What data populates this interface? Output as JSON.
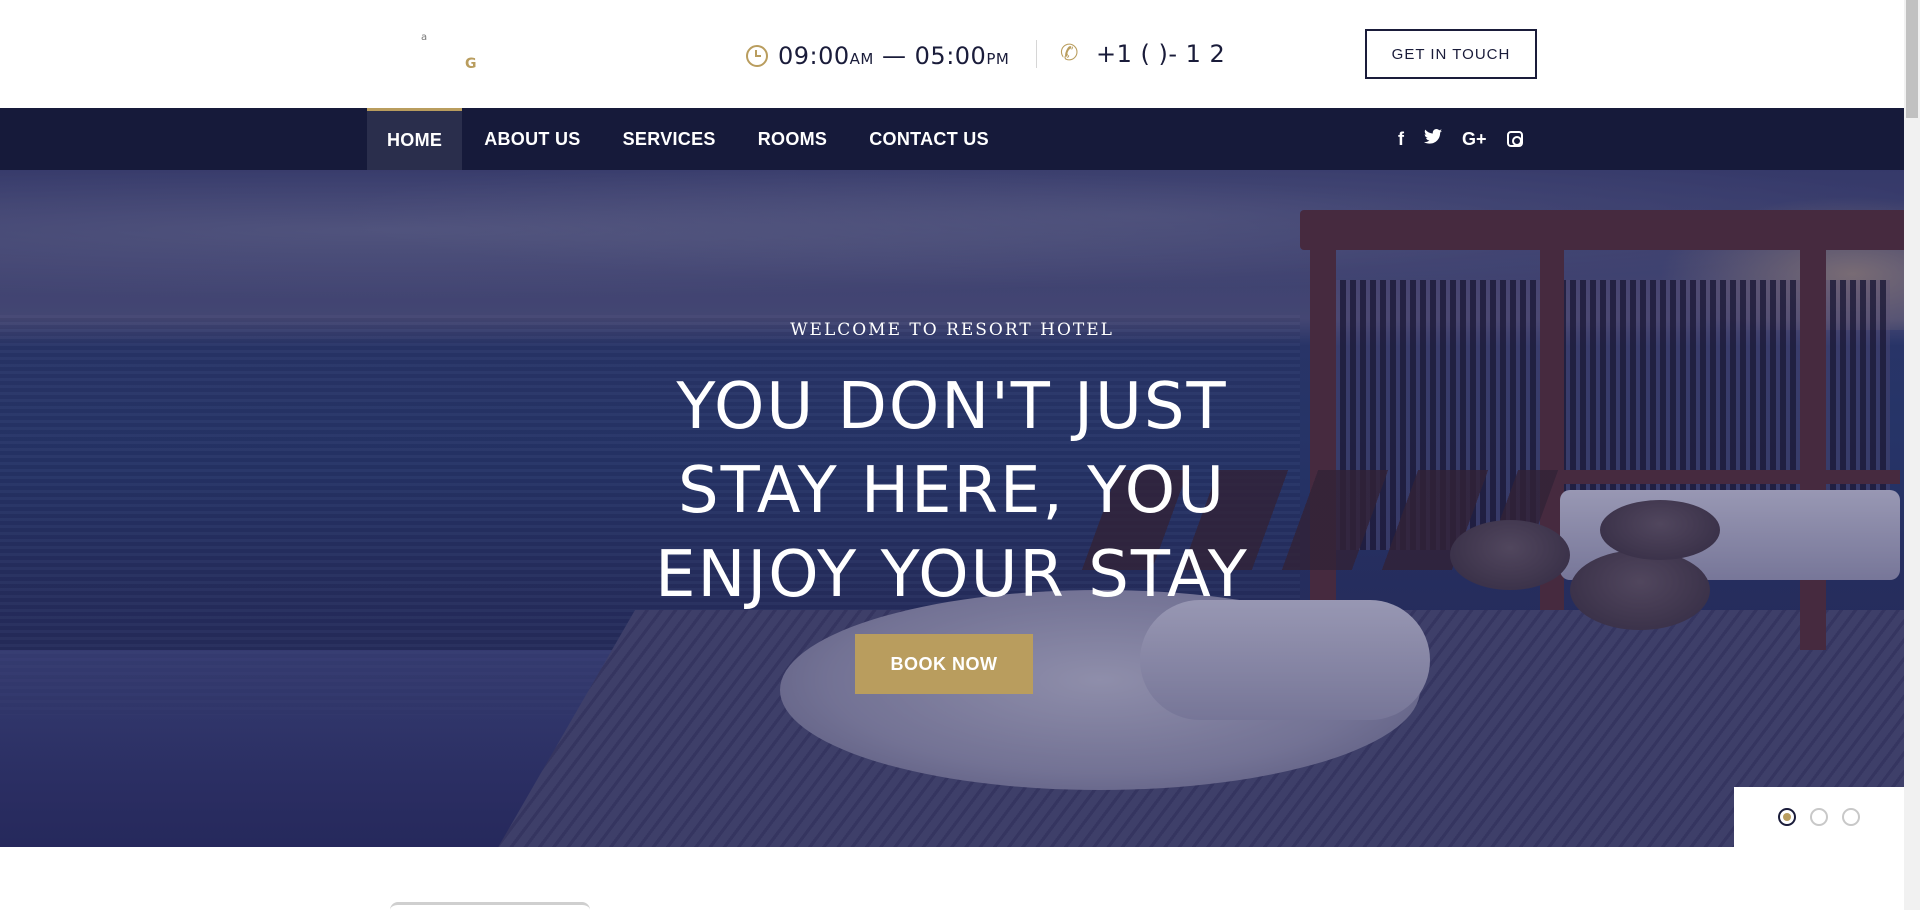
{
  "header": {
    "logo": {
      "line1": "a",
      "line2": "G"
    },
    "hours": {
      "open": "09:00",
      "open_suffix": "AM",
      "separator": "—",
      "close": "05:00",
      "close_suffix": "PM"
    },
    "phone": "+1 (   )-     1   2",
    "cta_label": "GET IN TOUCH"
  },
  "nav": {
    "items": [
      {
        "label": "HOME",
        "active": true
      },
      {
        "label": "ABOUT US",
        "active": false
      },
      {
        "label": "SERVICES",
        "active": false
      },
      {
        "label": "ROOMS",
        "active": false
      },
      {
        "label": "CONTACT US",
        "active": false
      }
    ],
    "social": [
      {
        "icon": "facebook-icon",
        "glyph": "f"
      },
      {
        "icon": "twitter-icon",
        "glyph": "🐦"
      },
      {
        "icon": "google-plus-icon",
        "glyph": "G+"
      },
      {
        "icon": "instagram-icon",
        "glyph": ""
      }
    ]
  },
  "hero": {
    "welcome": "WELCOME TO RESORT HOTEL",
    "headline_lines": [
      "YOU DON'T JUST",
      "STAY HERE, YOU",
      "ENJOY YOUR STAY"
    ],
    "cta_label": "BOOK NOW",
    "slides": {
      "count": 3,
      "active_index": 0
    }
  },
  "colors": {
    "accent_gold": "#b99d5e",
    "nav_navy": "#161a3a",
    "text_dark": "#1a1c3a"
  }
}
